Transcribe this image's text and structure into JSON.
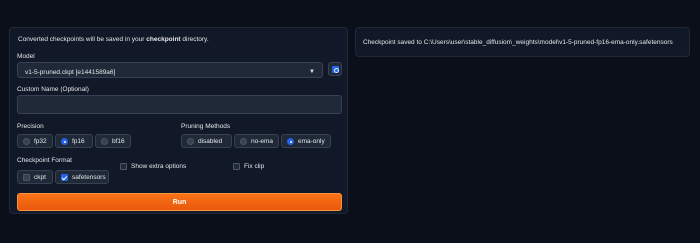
{
  "info": {
    "prefix": "Converted checkpoints will be saved in your ",
    "bold": "checkpoint",
    "suffix": " directory."
  },
  "model": {
    "label": "Model",
    "selected": "v1-5-pruned.ckpt [e1441589a6]"
  },
  "custom_name": {
    "label": "Custom Name (Optional)",
    "value": ""
  },
  "precision": {
    "label": "Precision",
    "options": [
      "fp32",
      "fp16",
      "bf16"
    ],
    "selected": "fp16"
  },
  "pruning": {
    "label": "Pruning Methods",
    "options": [
      "disabled",
      "no-ema",
      "ema-only"
    ],
    "selected": "ema-only"
  },
  "checkpoint_format": {
    "label": "Checkpoint Format",
    "options": [
      "ckpt",
      "safetensors"
    ],
    "selected": "safetensors"
  },
  "extra": {
    "show_extra_label": "Show extra options",
    "fix_clip_label": "Fix clip"
  },
  "run_label": "Run",
  "output": {
    "message": "Checkpoint saved to C:\\Users\\user\\stable_diffusion\\_weights\\model\\v1-5-pruned-fp16-ema-only.safetensors"
  },
  "colors": {
    "background": "#0b0f19",
    "panel": "#111827",
    "accent": "#2563eb",
    "run_button": "#f97316"
  }
}
